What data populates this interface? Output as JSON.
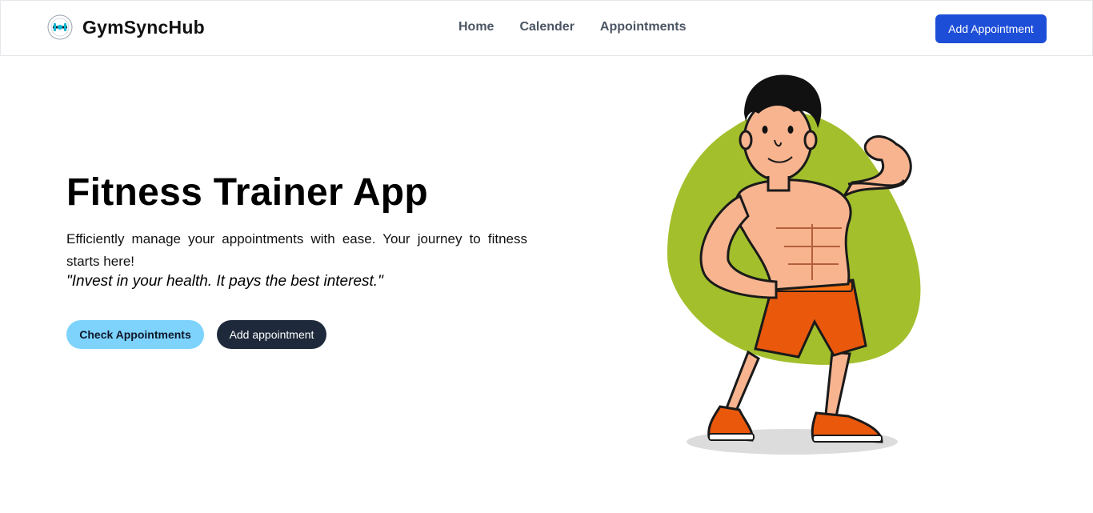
{
  "navbar": {
    "brand": "GymSyncHub",
    "links": [
      "Home",
      "Calender",
      "Appointments"
    ],
    "cta_label": "Add Appointment"
  },
  "hero": {
    "title": "Fitness Trainer App",
    "description": "Efficiently manage your appointments with ease. Your journey to fitness starts here!",
    "quote": "\"Invest in your health. It pays the best interest.\"",
    "primary_button": "Check Appointments",
    "secondary_button": "Add appointment"
  },
  "icons": {
    "logo": "gym-logo-icon",
    "illustration": "muscular-trainer-illustration"
  },
  "colors": {
    "accent_blue": "#1d4ed8",
    "light_blue": "#7dd3fc",
    "dark_slate": "#1e293b",
    "blob_green": "#a3bf2c",
    "shorts_orange": "#ea580c"
  }
}
